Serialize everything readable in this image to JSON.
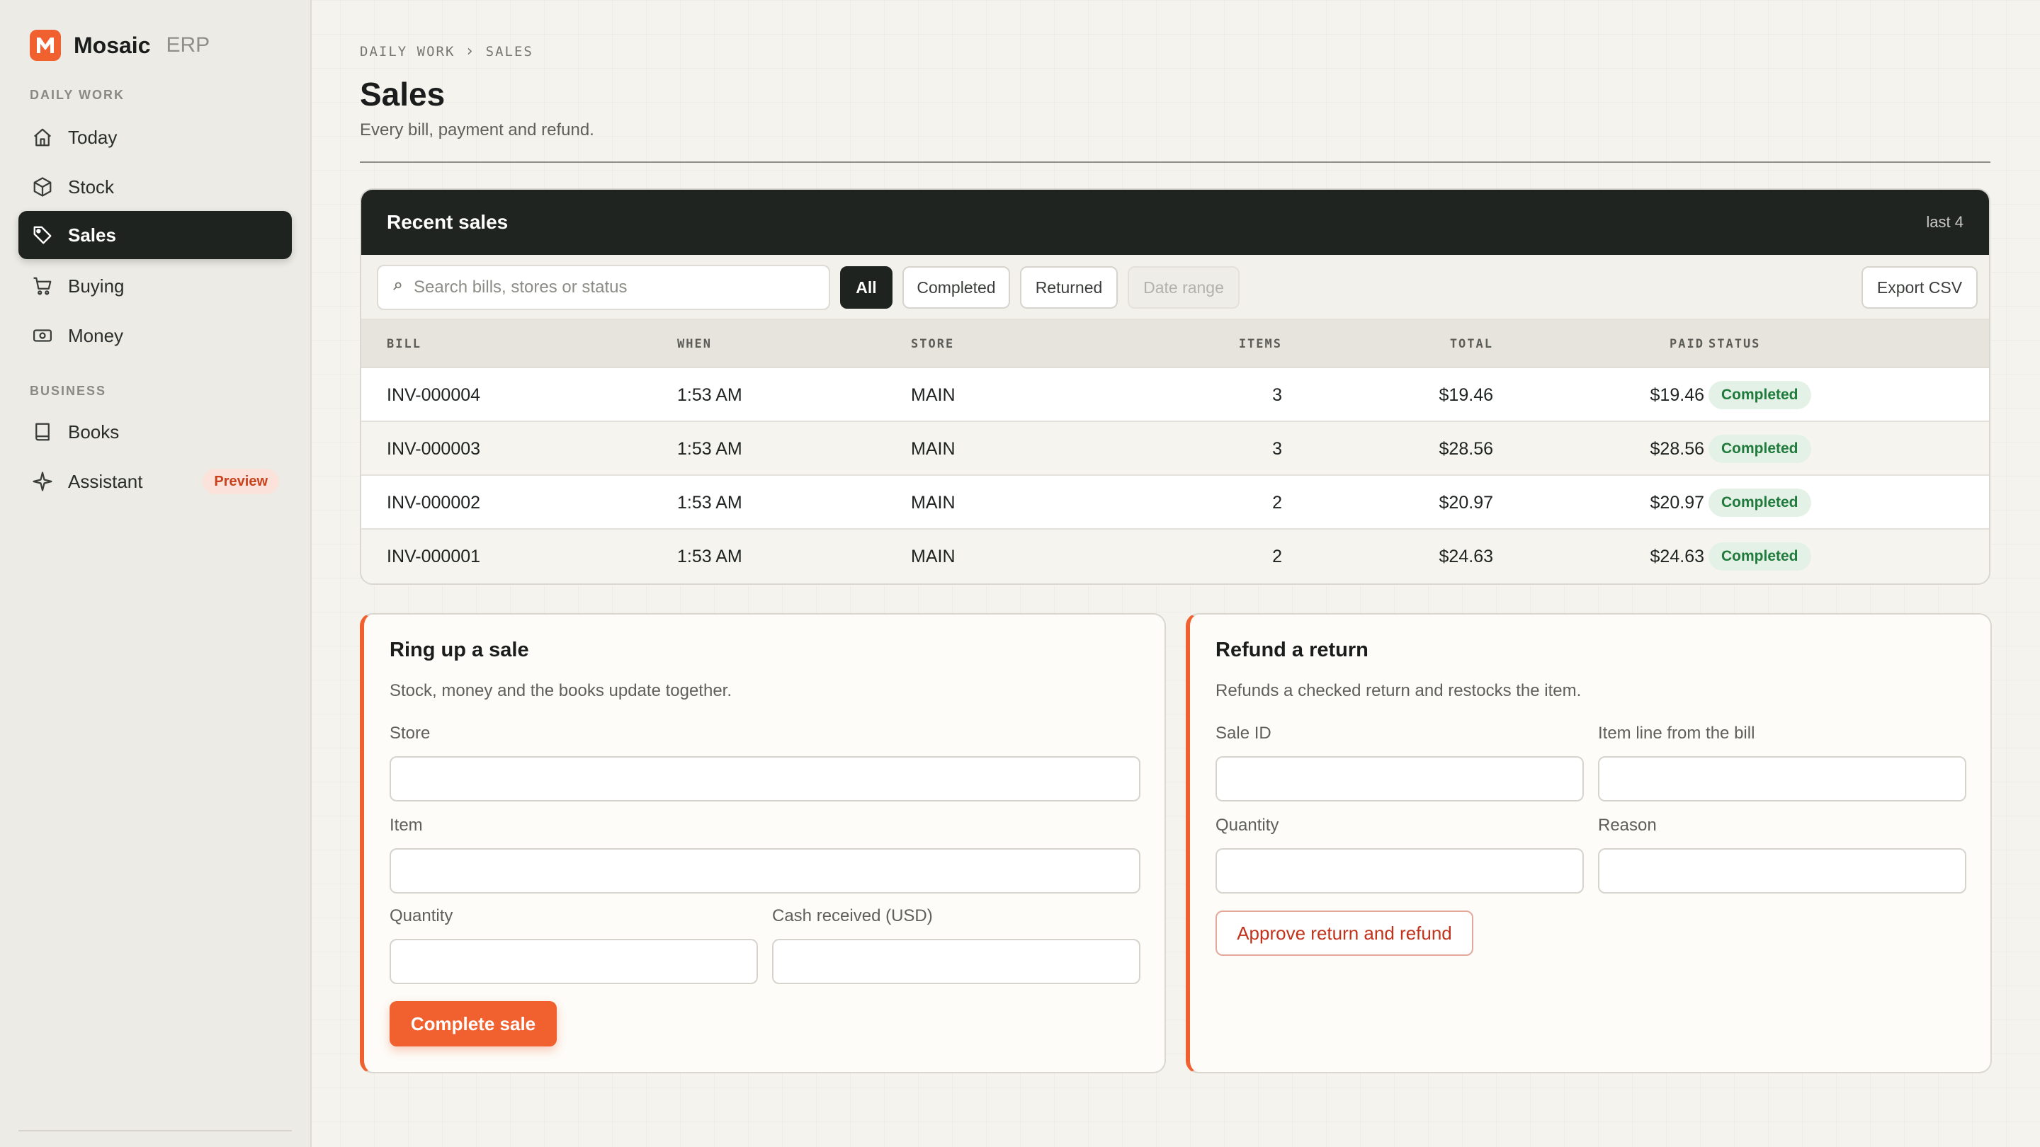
{
  "brand": {
    "name": "Mosaic",
    "suffix": "ERP"
  },
  "sidebar": {
    "sections": [
      {
        "label": "DAILY WORK"
      },
      {
        "label": "BUSINESS"
      }
    ],
    "items": [
      {
        "label": "Today",
        "icon": "home-icon"
      },
      {
        "label": "Stock",
        "icon": "box-icon"
      },
      {
        "label": "Sales",
        "icon": "tag-icon",
        "active": true
      },
      {
        "label": "Buying",
        "icon": "cart-icon"
      },
      {
        "label": "Money",
        "icon": "banknote-icon"
      },
      {
        "label": "Books",
        "icon": "book-icon"
      },
      {
        "label": "Assistant",
        "icon": "sparkle-icon",
        "badge": "Preview"
      }
    ]
  },
  "breadcrumb": {
    "parent": "DAILY WORK",
    "current": "SALES"
  },
  "page": {
    "title": "Sales",
    "subtitle": "Every bill, payment and refund."
  },
  "sales": {
    "title": "Recent sales",
    "count_label": "last 4",
    "search": {
      "placeholder": "Search bills, stores or status",
      "value": ""
    },
    "filters": {
      "all": "All",
      "completed": "Completed",
      "returned": "Returned",
      "date_range": "Date range"
    },
    "export_label": "Export CSV",
    "columns": {
      "bill": "BILL",
      "when": "WHEN",
      "store": "STORE",
      "items": "ITEMS",
      "total": "TOTAL",
      "paid": "PAID",
      "status": "STATUS"
    },
    "rows": [
      {
        "bill": "INV-000004",
        "when": "1:53 AM",
        "store": "MAIN",
        "items": "3",
        "total": "$19.46",
        "paid": "$19.46",
        "status": "Completed"
      },
      {
        "bill": "INV-000003",
        "when": "1:53 AM",
        "store": "MAIN",
        "items": "3",
        "total": "$28.56",
        "paid": "$28.56",
        "status": "Completed"
      },
      {
        "bill": "INV-000002",
        "when": "1:53 AM",
        "store": "MAIN",
        "items": "2",
        "total": "$20.97",
        "paid": "$20.97",
        "status": "Completed"
      },
      {
        "bill": "INV-000001",
        "when": "1:53 AM",
        "store": "MAIN",
        "items": "2",
        "total": "$24.63",
        "paid": "$24.63",
        "status": "Completed"
      }
    ]
  },
  "sale_form": {
    "title": "Ring up a sale",
    "description": "Stock, money and the books update together.",
    "store_label": "Store",
    "item_label": "Item",
    "quantity_label": "Quantity",
    "cash_label": "Cash received (USD)",
    "submit_label": "Complete sale"
  },
  "refund_form": {
    "title": "Refund a return",
    "description": "Refunds a checked return and restocks the item.",
    "sale_id_label": "Sale ID",
    "item_line_label": "Item line from the bill",
    "quantity_label": "Quantity",
    "reason_label": "Reason",
    "submit_label": "Approve return and refund"
  },
  "colors": {
    "accent": "#f0612f",
    "dark": "#1f2320",
    "success": "#1f7a3b",
    "danger": "#c0321c"
  }
}
